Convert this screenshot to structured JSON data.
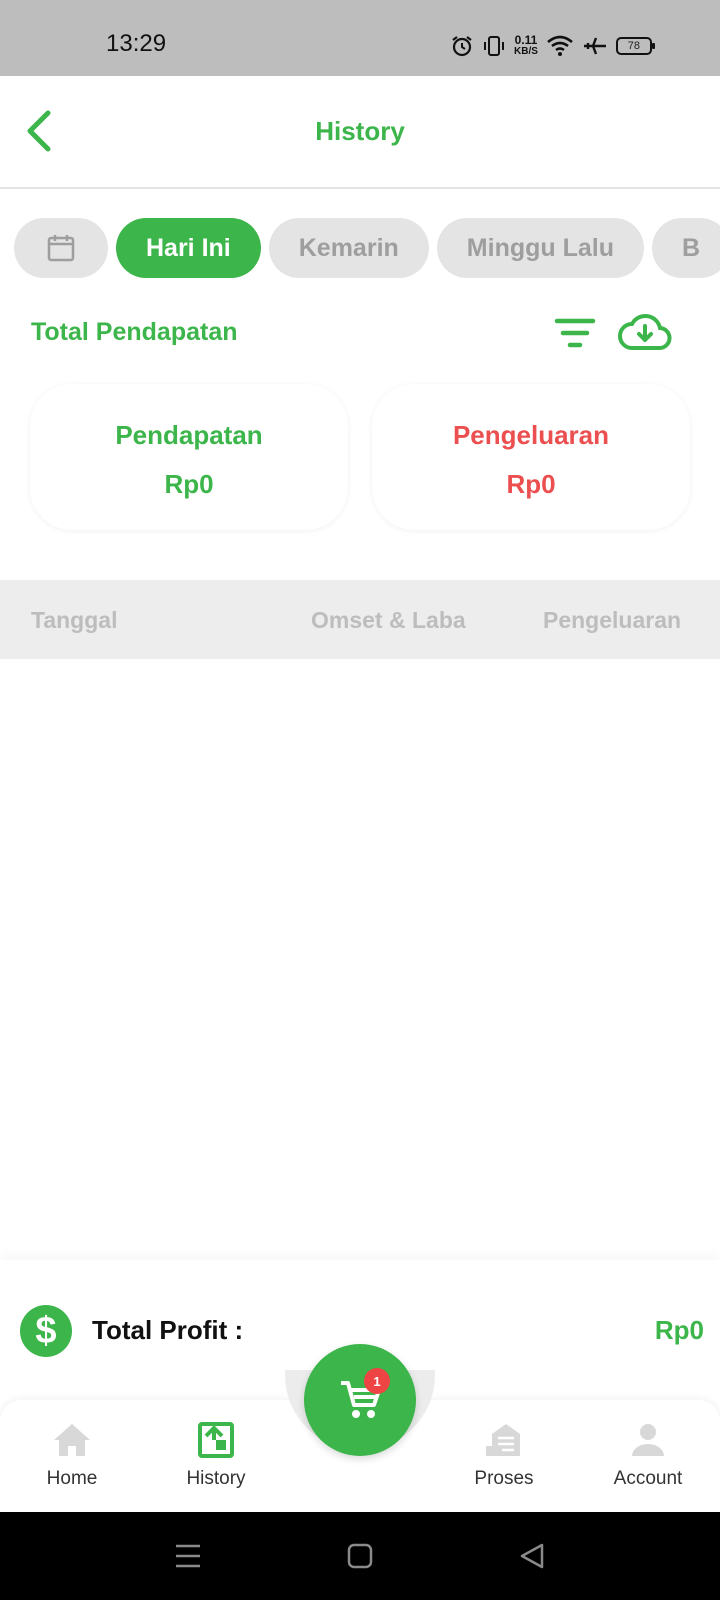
{
  "status_bar": {
    "time": "13:29",
    "speed_value": "0.11",
    "speed_unit": "KB/S",
    "battery": "78"
  },
  "header": {
    "title": "History"
  },
  "chips": [
    {
      "label": "Hari Ini"
    },
    {
      "label": "Kemarin"
    },
    {
      "label": "Minggu Lalu"
    },
    {
      "label": "B"
    }
  ],
  "summary": {
    "title": "Total Pendapatan",
    "income_label": "Pendapatan",
    "income_value": "Rp0",
    "expense_label": "Pengeluaran",
    "expense_value": "Rp0"
  },
  "table": {
    "columns": [
      "Tanggal",
      "Omset & Laba",
      "Pengeluaran"
    ]
  },
  "profit": {
    "icon_glyph": "$",
    "label": "Total Profit :",
    "value": "Rp0"
  },
  "cart": {
    "badge": "1"
  },
  "nav": {
    "home": "Home",
    "history": "History",
    "proses": "Proses",
    "account": "Account"
  },
  "colors": {
    "primary": "#3cb54a",
    "danger": "#ec4f4f",
    "chip_inactive": "#e4e4e4",
    "badge": "#ef4444"
  }
}
